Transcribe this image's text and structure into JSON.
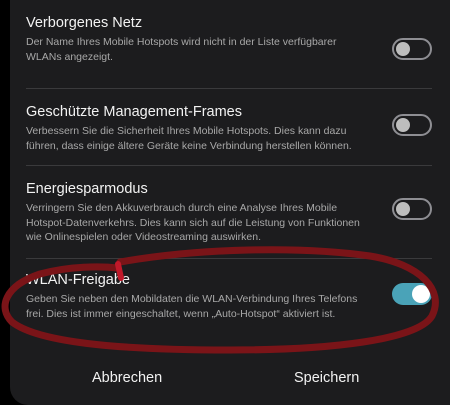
{
  "settings": [
    {
      "title": "Verborgenes Netz",
      "description": "Der Name Ihres Mobile Hotspots wird nicht in der Liste verfügbarer WLANs angezeigt.",
      "enabled": false
    },
    {
      "title": "Geschützte Management-Frames",
      "description": "Verbessern Sie die Sicherheit Ihres Mobile Hotspots. Dies kann dazu führen, dass einige ältere Geräte keine Verbindung herstellen können.",
      "enabled": false
    },
    {
      "title": "Energiesparmodus",
      "description": "Verringern Sie den Akkuverbrauch durch eine Analyse Ihres Mobile Hotspot-Datenverkehrs. Dies kann sich auf die Leistung von Funktionen wie Onlinespielen oder Videostreaming auswirken.",
      "enabled": false
    },
    {
      "title": "WLAN-Freigabe",
      "description": "Geben Sie neben den Mobildaten die WLAN-Verbindung Ihres Telefons frei. Dies ist immer eingeschaltet, wenn „Auto-Hotspot“ aktiviert ist.",
      "enabled": true
    }
  ],
  "footer": {
    "cancel_label": "Abbrechen",
    "save_label": "Speichern"
  },
  "colors": {
    "background": "#1c1c1e",
    "toggle_on": "#4aa3b8",
    "annotation": "#7a1418"
  }
}
